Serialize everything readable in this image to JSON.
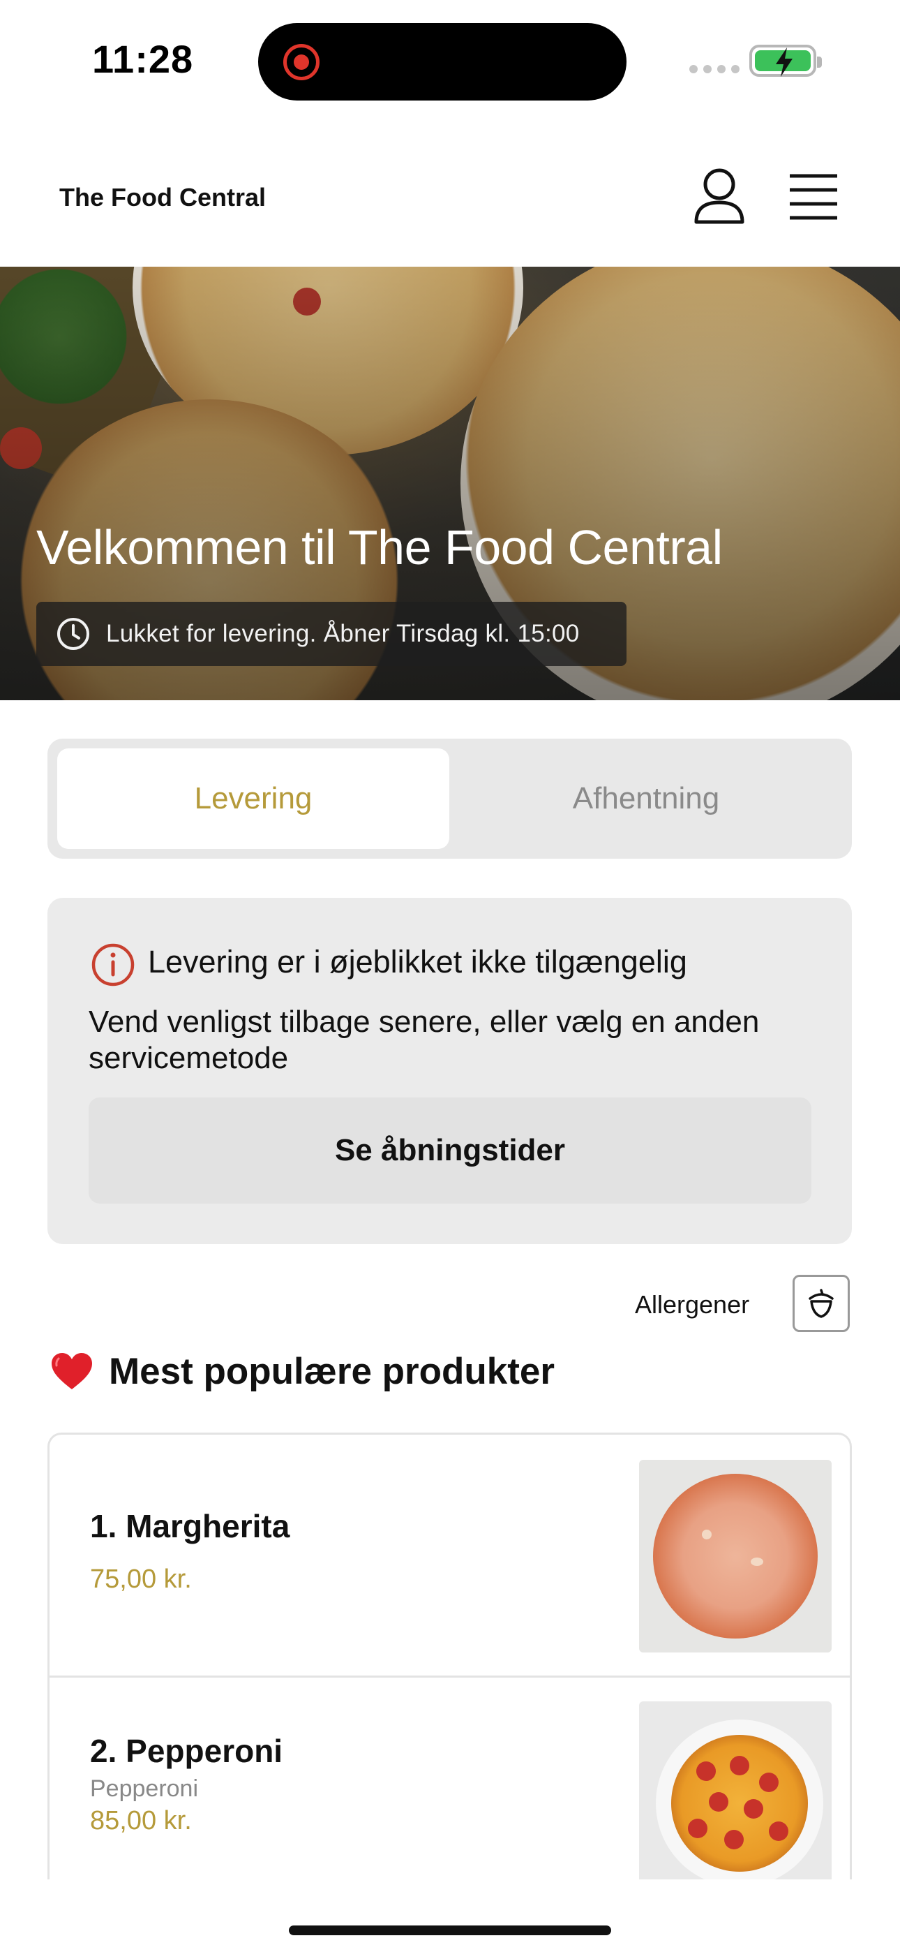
{
  "status_bar": {
    "time": "11:28"
  },
  "header": {
    "brand": "The Food Central",
    "user_icon": "user-icon",
    "menu_icon": "hamburger-menu-icon"
  },
  "hero": {
    "title": "Velkommen til The Food Central",
    "status_text": "Lukket for levering. Åbner Tirsdag kl. 15:00",
    "status_icon": "clock-icon"
  },
  "tabs": [
    {
      "label": "Levering",
      "active": true
    },
    {
      "label": "Afhentning",
      "active": false
    }
  ],
  "notice": {
    "icon": "info-icon",
    "title": "Levering er i øjeblikket ikke tilgængelig",
    "body": "Vend venligst tilbage senere, eller vælg en anden servicemetode",
    "button_label": "Se åbningstider"
  },
  "allergens": {
    "label": "Allergener",
    "icon": "acorn-icon"
  },
  "popular": {
    "icon": "heart-icon",
    "title": "Mest populære produkter",
    "products": [
      {
        "name": "1. Margherita",
        "description": "",
        "price": "75,00 kr."
      },
      {
        "name": "2. Pepperoni",
        "description": "Pepperoni",
        "price": "85,00 kr."
      }
    ]
  },
  "colors": {
    "accent_gold": "#b59a3a",
    "error_red": "#c8402f",
    "card_bg": "#ebebeb"
  }
}
